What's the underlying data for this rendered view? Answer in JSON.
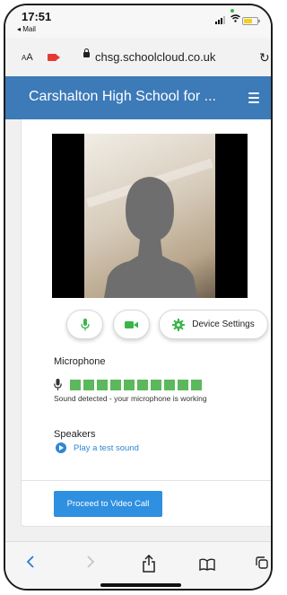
{
  "status_bar": {
    "time": "17:51",
    "back_app": "◂ Mail"
  },
  "browser": {
    "text_size": "AA",
    "url": "chsg.schoolcloud.co.uk"
  },
  "site_header": {
    "title": "Carshalton High School for ..."
  },
  "device_check": {
    "device_settings_label": "Device Settings",
    "microphone": {
      "heading": "Microphone",
      "level_segments": 10,
      "level_color": "#5cb85c",
      "status_text": "Sound detected - your microphone is working"
    },
    "speakers": {
      "heading": "Speakers",
      "test_sound_label": "Play a test sound"
    },
    "proceed_label": "Proceed to Video Call"
  },
  "colors": {
    "header_blue": "#3c7ab8",
    "accent_green": "#3bb54a",
    "link_blue": "#2f87d4",
    "button_blue": "#2f8fe0"
  }
}
